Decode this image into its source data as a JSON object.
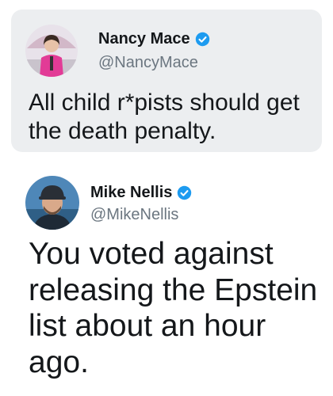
{
  "tweets": [
    {
      "display_name": "Nancy Mace",
      "handle": "@NancyMace",
      "text": "All child r*pists should get the death penalty.",
      "verified": true,
      "avatar_icon": "profile-photo"
    },
    {
      "display_name": "Mike Nellis",
      "handle": "@MikeNellis",
      "text": "You voted against releasing the Epstein list about an hour ago.",
      "verified": true,
      "avatar_icon": "profile-photo"
    }
  ],
  "colors": {
    "verified_blue": "#1d9bf0",
    "quoted_card_bg": "#eceef0",
    "handle_gray": "#6b7680"
  }
}
